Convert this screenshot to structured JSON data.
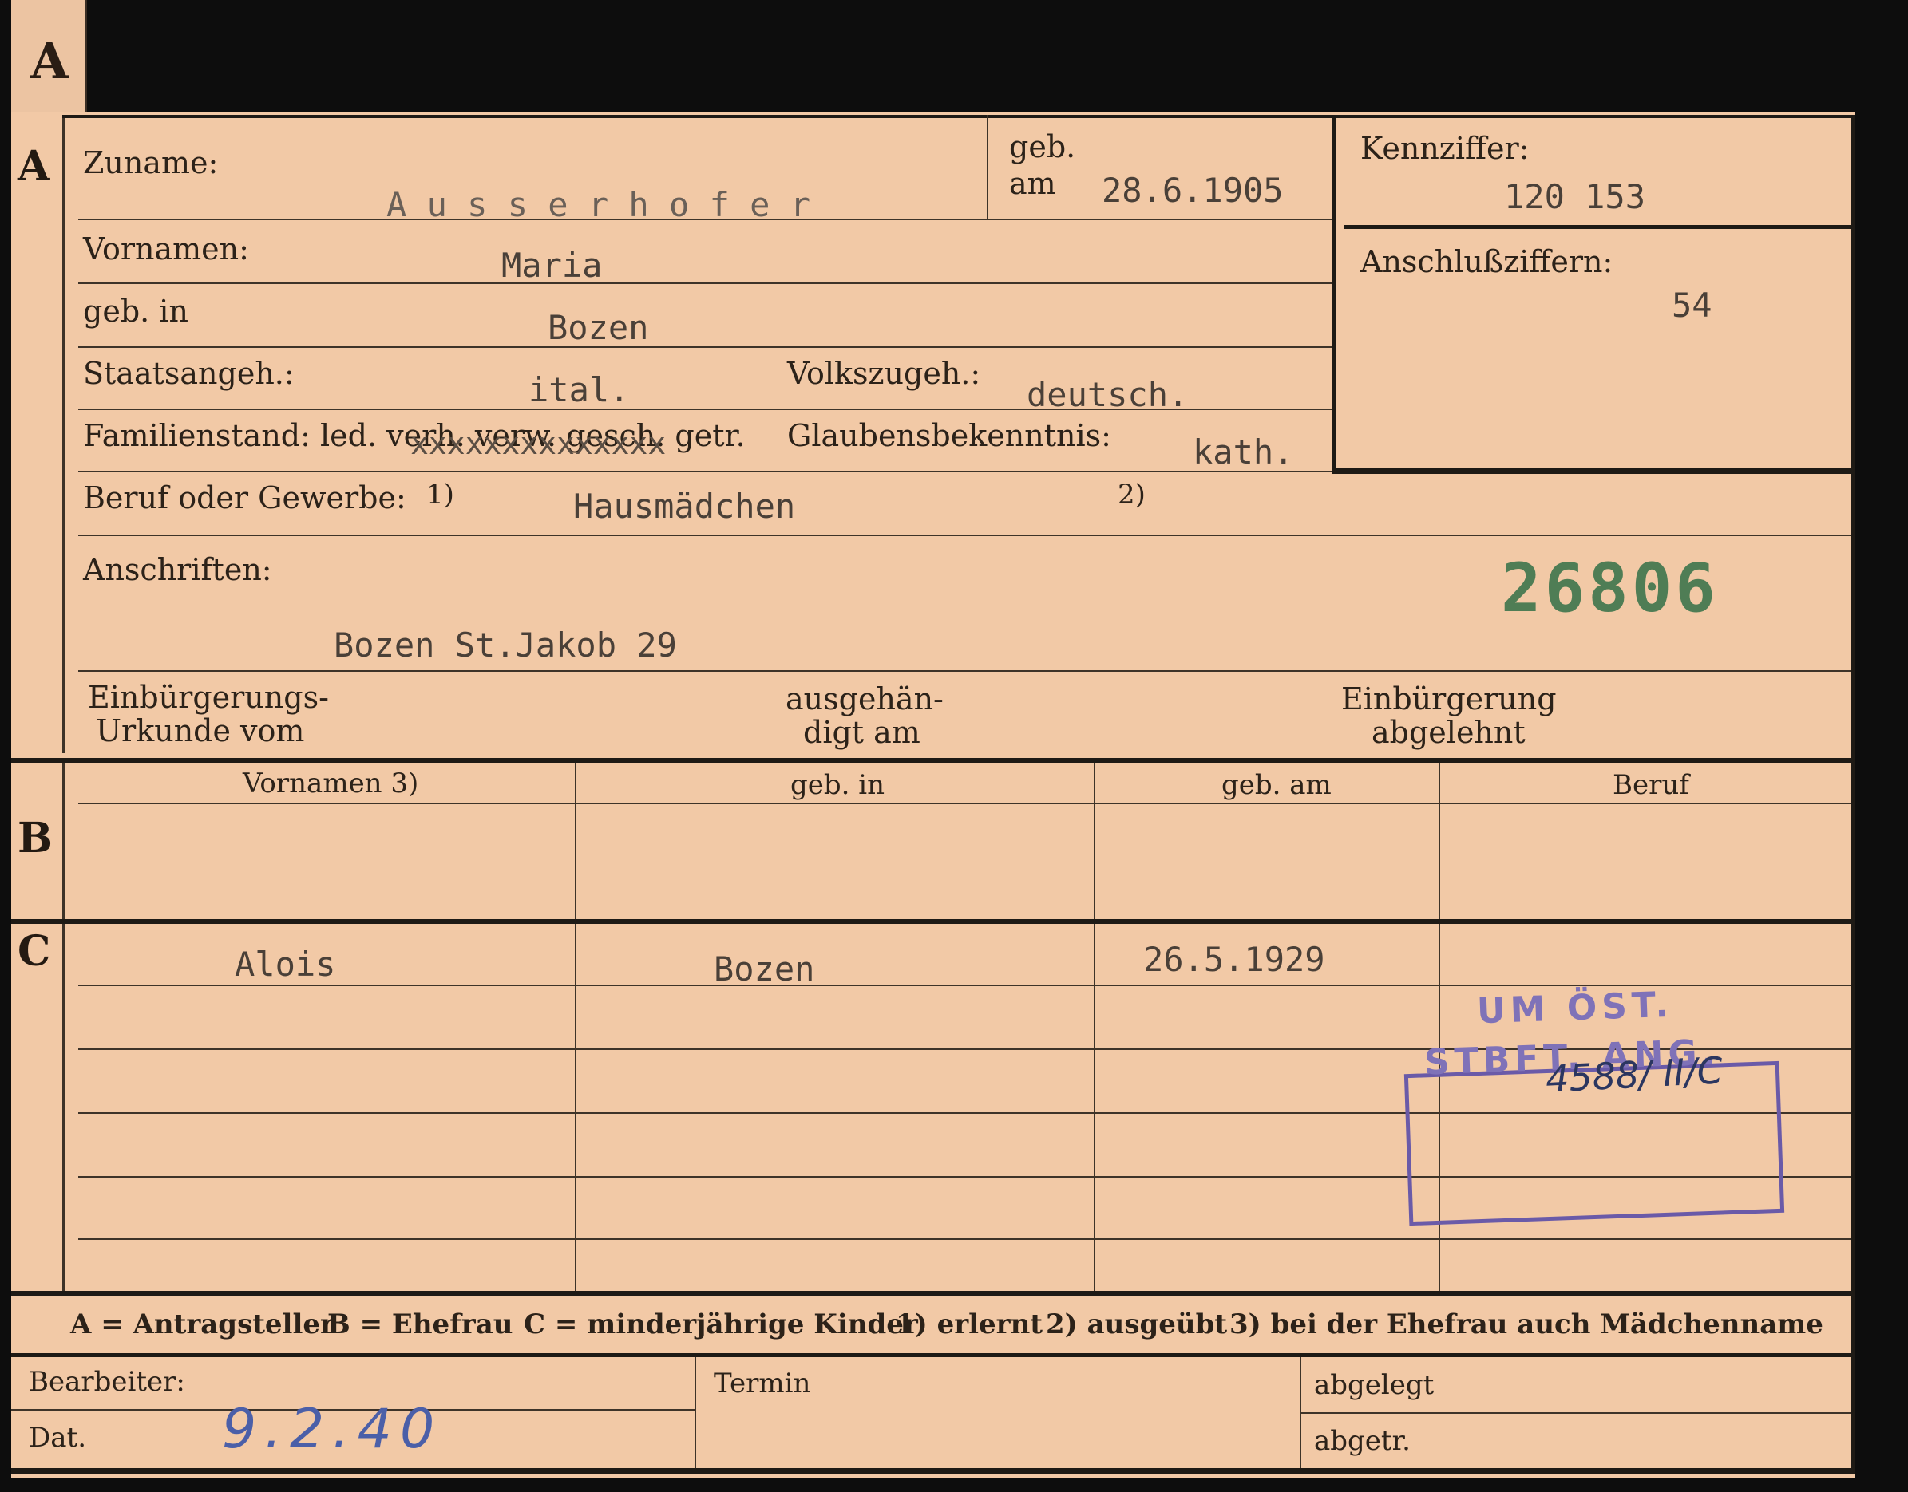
{
  "tab_letter": "A",
  "section_letters": {
    "a": "A",
    "b": "B",
    "c": "C"
  },
  "section_a": {
    "zuname_label": "Zuname:",
    "zuname_value": "A u s s e r h o f e r",
    "geb_label": "geb.",
    "am_label": "am",
    "geb_am_value": "28.6.1905",
    "kennziffer_label": "Kennziffer:",
    "kennziffer_value": "120 153",
    "anschluss_label": "Anschlußziffern:",
    "anschluss_value": "54",
    "vornamen_label": "Vornamen:",
    "vornamen_value": "Maria",
    "gebin_label": "geb. in",
    "gebin_value": "Bozen",
    "staat_label": "Staatsangeh.:",
    "staat_value": "ital.",
    "volks_label": "Volkszugeh.:",
    "volks_value": "deutsch.",
    "familien_label": "Familienstand: led. verh. verw. gesch. getr.",
    "familien_strike": "xxxxxxxxxxxxxx",
    "glaubens_label": "Glaubensbekenntnis:",
    "glaubens_value": "kath.",
    "beruf_label": "Beruf oder Gewerbe:",
    "beruf_note1": "1)",
    "beruf_value": "Hausmädchen",
    "beruf_note2": "2)",
    "anschriften_label": "Anschriften:",
    "anschriften_value": "Bozen St.Jakob 29",
    "stamp_number": "26806",
    "einb_label_1": "Einbürgerungs-",
    "einb_label_2": "Urkunde vom",
    "ausg_label_1": "ausgehän-",
    "ausg_label_2": "digt am",
    "abgel_label_1": "Einbürgerung",
    "abgel_label_2": "abgelehnt"
  },
  "section_b": {
    "headers": [
      "Vornamen 3)",
      "geb. in",
      "geb. am",
      "Beruf"
    ]
  },
  "section_c": {
    "rows": [
      {
        "vorname": "Alois",
        "gebin": "Bozen",
        "gebam": "26.5.1929"
      }
    ],
    "stamp_line1": "UM ÖST.",
    "stamp_line2": "STBFT. ANG.",
    "stamp_handwritten": "4588/ II/C"
  },
  "legend": {
    "a": "A = Antragsteller",
    "b": "B = Ehefrau",
    "c": "C = minderjährige Kinder",
    "n1": "1) erlernt",
    "n2": "2) ausgeübt",
    "n3": "3) bei der Ehefrau auch Mädchenname"
  },
  "bottom": {
    "bearbeiter_label": "Bearbeiter:",
    "dat_label": "Dat.",
    "dat_value": "9.2.40",
    "termin_label": "Termin",
    "abgelegt_label": "abgelegt",
    "abgetr_label": "abgetr."
  },
  "colors": {
    "card": "#f2c9a6",
    "ink": "#2a2018",
    "green_stamp": "#4f7d55",
    "violet_stamp": "#7f72b8",
    "blue_pencil": "#4b5fa8"
  }
}
